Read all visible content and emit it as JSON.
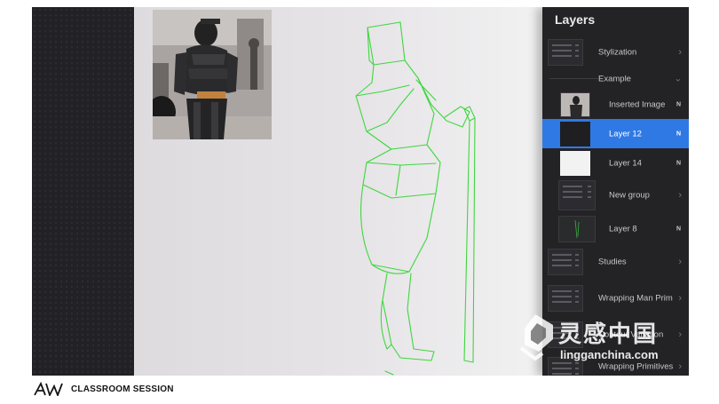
{
  "panel": {
    "title": "Layers",
    "layers": [
      {
        "label": "Stylization",
        "kind": "group",
        "thumb": "stack"
      },
      {
        "label": "Example",
        "kind": "group-open"
      },
      {
        "label": "Inserted Image",
        "kind": "layer",
        "mode": "N",
        "thumb": "photo"
      },
      {
        "label": "Layer 12",
        "kind": "layer",
        "mode": "N",
        "thumb": "dark",
        "selected": true
      },
      {
        "label": "Layer 14",
        "kind": "layer",
        "mode": "N",
        "thumb": "white"
      },
      {
        "label": "New group",
        "kind": "group",
        "thumb": "stack"
      },
      {
        "label": "Layer 8",
        "kind": "layer",
        "mode": "N",
        "thumb": "green"
      },
      {
        "label": "Studies",
        "kind": "group",
        "thumb": "stack"
      },
      {
        "label": "Wrapping Man Prim",
        "kind": "group",
        "thumb": "stack"
      },
      {
        "label": "Contour Variation",
        "kind": "group",
        "thumb": "stack"
      },
      {
        "label": "Wrapping Primitives",
        "kind": "group",
        "thumb": "stack"
      }
    ]
  },
  "colors": {
    "accent": "#2f79e4",
    "sketch_stroke": "#3fd63f",
    "panel_bg": "#232326"
  },
  "footer": {
    "text": "CLASSROOM SESSION",
    "logo": "AW"
  },
  "watermark": {
    "cn": "灵感中国",
    "url": "lingganchina.com"
  }
}
